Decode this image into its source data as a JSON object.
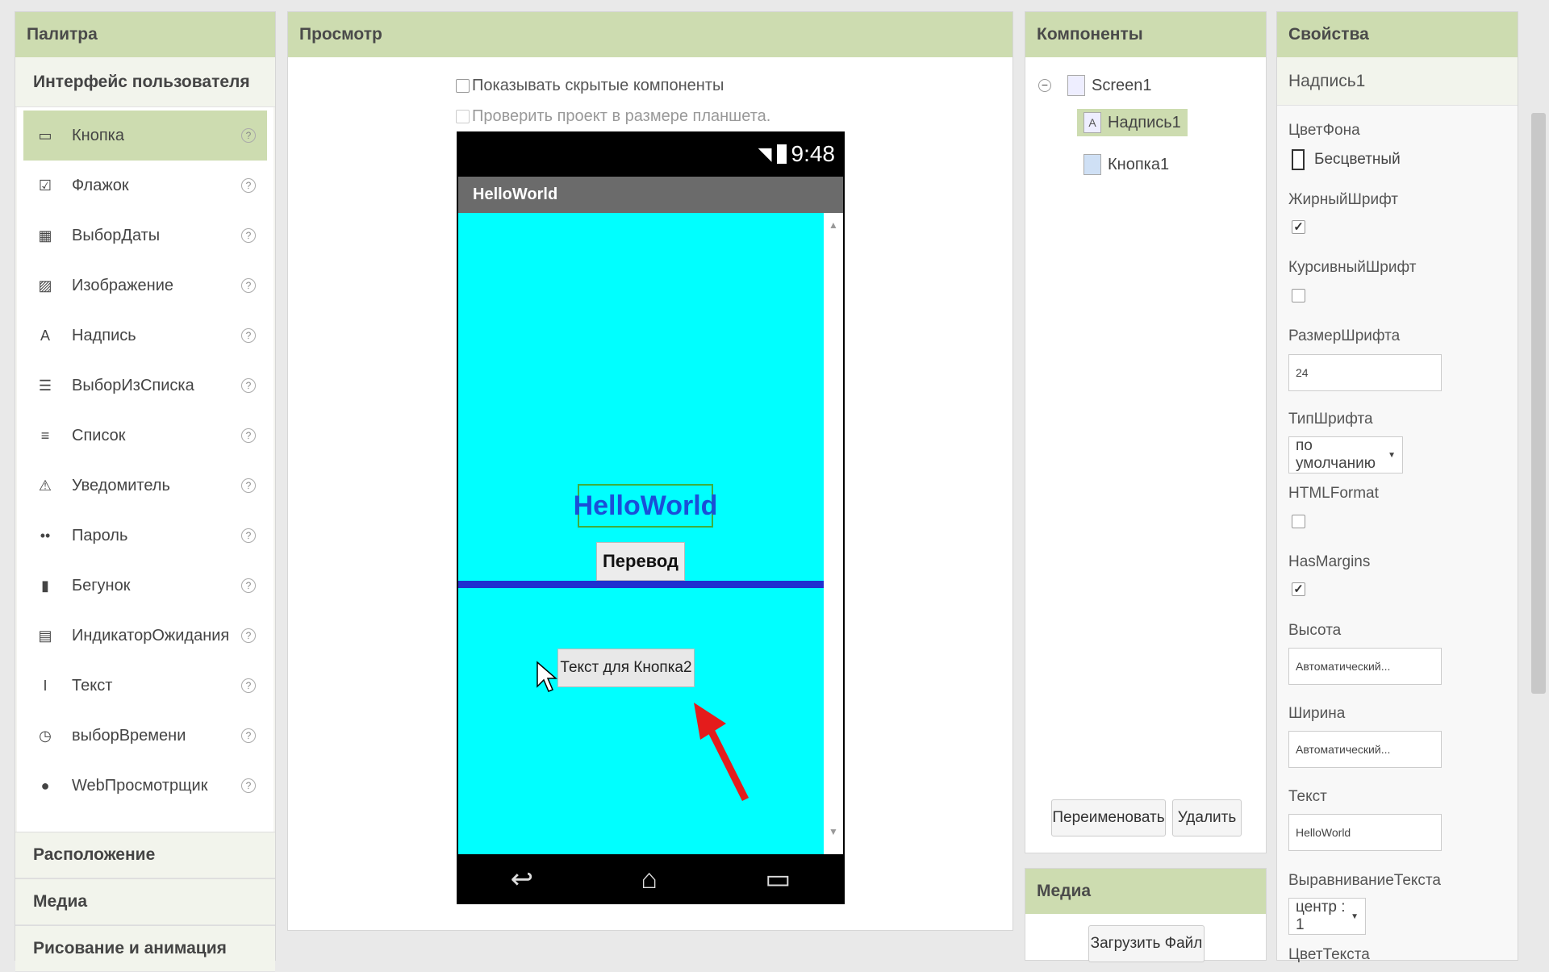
{
  "palette": {
    "title": "Палитра",
    "category_open": "Интерфейс пользователя",
    "items": [
      {
        "label": "Кнопка",
        "icon": "button-icon",
        "selected": true
      },
      {
        "label": "Флажок",
        "icon": "checkbox-icon"
      },
      {
        "label": "ВыборДаты",
        "icon": "datepicker-icon"
      },
      {
        "label": "Изображение",
        "icon": "image-icon"
      },
      {
        "label": "Надпись",
        "icon": "label-icon"
      },
      {
        "label": "ВыборИзСписка",
        "icon": "listpicker-icon"
      },
      {
        "label": "Список",
        "icon": "listview-icon"
      },
      {
        "label": "Уведомитель",
        "icon": "notifier-icon"
      },
      {
        "label": "Пароль",
        "icon": "password-icon"
      },
      {
        "label": "Бегунок",
        "icon": "slider-icon"
      },
      {
        "label": "ИндикаторОжидания",
        "icon": "spinner-icon"
      },
      {
        "label": "Текст",
        "icon": "textbox-icon"
      },
      {
        "label": "выборВремени",
        "icon": "timepicker-icon"
      },
      {
        "label": "WebПросмотрщик",
        "icon": "webviewer-icon"
      }
    ],
    "categories": [
      "Расположение",
      "Медиа",
      "Рисование и анимация"
    ]
  },
  "viewer": {
    "title": "Просмотр",
    "show_hidden": "Показывать скрытые компоненты",
    "tablet_size": "Проверить проект в размере планшета.",
    "phone": {
      "time": "9:48",
      "app_title": "HelloWorld",
      "label_text": "HelloWorld",
      "button1": "Перевод",
      "button2": "Текст для Кнопка2"
    }
  },
  "components": {
    "title": "Компоненты",
    "tree": [
      "Screen1",
      "Надпись1",
      "Кнопка1"
    ],
    "rename": "Переименовать",
    "delete": "Удалить"
  },
  "media": {
    "title": "Медиа",
    "upload": "Загрузить Файл"
  },
  "properties": {
    "title": "Свойства",
    "component": "Надпись1",
    "bg_color_label": "ЦветФона",
    "bg_color_value": "Бесцветный",
    "bold_label": "ЖирныйШрифт",
    "bold": true,
    "italic_label": "КурсивныйШрифт",
    "italic": false,
    "font_size_label": "РазмерШрифта",
    "font_size": "24",
    "font_type_label": "ТипШрифта",
    "font_type": "по умолчанию",
    "html_label": "HTMLFormat",
    "html": false,
    "margins_label": "HasMargins",
    "margins": true,
    "height_label": "Высота",
    "height_value": "Автоматический...",
    "width_label": "Ширина",
    "width_value": "Автоматический...",
    "text_label": "Текст",
    "text_value": "HelloWorld",
    "align_label": "ВыравниваниеТекста",
    "align_value": "центр : 1",
    "text_color_label": "ЦветТекста"
  }
}
